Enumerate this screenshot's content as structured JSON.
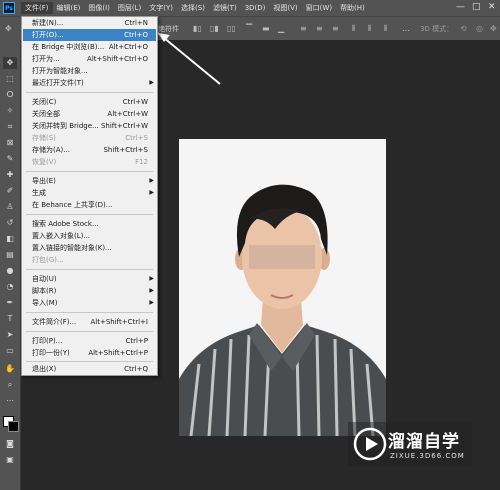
{
  "menubar": {
    "items": [
      "文件(F)",
      "编辑(E)",
      "图像(I)",
      "图层(L)",
      "文字(Y)",
      "选择(S)",
      "滤镜(T)",
      "3D(D)",
      "视图(V)",
      "窗口(W)",
      "帮助(H)"
    ]
  },
  "optionsbar": {
    "partial_label": "绝符件",
    "mode_label": "3D 模式："
  },
  "file_menu": {
    "items": [
      {
        "label": "新建(N)...",
        "shortcut": "Ctrl+N"
      },
      {
        "label": "打开(O)...",
        "shortcut": "Ctrl+O"
      },
      {
        "label": "在 Bridge 中浏览(B)...",
        "shortcut": "Alt+Ctrl+O"
      },
      {
        "label": "打开为...",
        "shortcut": "Alt+Shift+Ctrl+O"
      },
      {
        "label": "打开为智能对象...",
        "shortcut": ""
      },
      {
        "label": "最近打开文件(T)",
        "shortcut": ""
      },
      {
        "label": "关闭(C)",
        "shortcut": "Ctrl+W"
      },
      {
        "label": "关闭全部",
        "shortcut": "Alt+Ctrl+W"
      },
      {
        "label": "关闭并转到 Bridge...",
        "shortcut": "Shift+Ctrl+W"
      },
      {
        "label": "存储(S)",
        "shortcut": "Ctrl+S"
      },
      {
        "label": "存储为(A)...",
        "shortcut": "Shift+Ctrl+S"
      },
      {
        "label": "恢复(V)",
        "shortcut": "F12"
      },
      {
        "label": "导出(E)",
        "shortcut": ""
      },
      {
        "label": "生成",
        "shortcut": ""
      },
      {
        "label": "在 Behance 上共享(D)...",
        "shortcut": ""
      },
      {
        "label": "搜索 Adobe Stock...",
        "shortcut": ""
      },
      {
        "label": "置入嵌入对象(L)...",
        "shortcut": ""
      },
      {
        "label": "置入链接的智能对象(K)...",
        "shortcut": ""
      },
      {
        "label": "打包(G)...",
        "shortcut": ""
      },
      {
        "label": "自动(U)",
        "shortcut": ""
      },
      {
        "label": "脚本(R)",
        "shortcut": ""
      },
      {
        "label": "导入(M)",
        "shortcut": ""
      },
      {
        "label": "文件简介(F)...",
        "shortcut": "Alt+Shift+Ctrl+I"
      },
      {
        "label": "打印(P)...",
        "shortcut": "Ctrl+P"
      },
      {
        "label": "打印一份(Y)",
        "shortcut": "Alt+Shift+Ctrl+P"
      },
      {
        "label": "退出(X)",
        "shortcut": "Ctrl+Q"
      }
    ]
  },
  "watermark": {
    "title": "溜溜自学",
    "subtitle": "ZIXUE.3D66.COM"
  },
  "colors": {
    "menu_highlight": "#3c83c6",
    "ui_panel": "#535353",
    "workspace": "#282828"
  }
}
